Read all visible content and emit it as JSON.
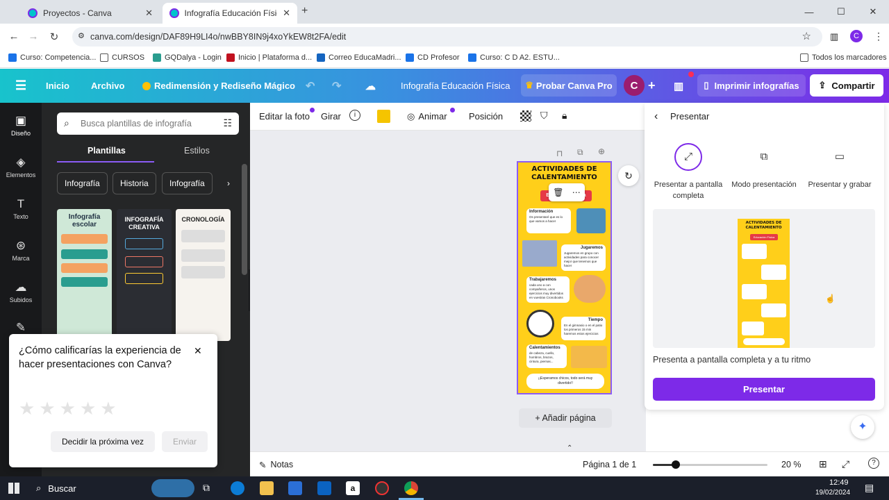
{
  "browser": {
    "tabs": [
      {
        "title": "Proyectos - Canva"
      },
      {
        "title": "Infografía Educación Física - Inf"
      }
    ],
    "url": "canva.com/design/DAF89H9LI4o/nwBBY8IN9j4xoYkEW8t2FA/edit",
    "bookmarks": [
      "Curso: Competencia...",
      "CURSOS",
      "GQDalya - Login",
      "Inicio | Plataforma d...",
      "Correo EducaMadri...",
      "CD Profesor",
      "Curso: C D A2. ESTU..."
    ],
    "bookmarks_all": "Todos los marcadores",
    "profile_initial": "C"
  },
  "canva_header": {
    "inicio": "Inicio",
    "archivo": "Archivo",
    "magic": "Redimensión y Rediseño Mágico",
    "doc_title": "Infografía Educación Física",
    "probar": "Probar Canva Pro",
    "avatar": "C",
    "imprimir": "Imprimir infografías",
    "compartir": "Compartir"
  },
  "rail": [
    "Diseño",
    "Elementos",
    "Texto",
    "Marca",
    "Subidos"
  ],
  "panel": {
    "search_placeholder": "Busca plantillas de infografía",
    "tabs": [
      "Plantillas",
      "Estilos"
    ],
    "chips": [
      "Infografía",
      "Historia",
      "Infografía"
    ],
    "thumbs": [
      {
        "title": "Infografía escolar"
      },
      {
        "title": "INFOGRAFÍA CREATIVA"
      },
      {
        "title": "CRONOLOGÍA"
      }
    ]
  },
  "rating": {
    "question": "¿Cómo calificarías la experiencia de hacer presentaciones con Canva?",
    "later": "Decidir la próxima vez",
    "send": "Enviar",
    "stars_selected": 0,
    "stars_total": 5
  },
  "toolbar": {
    "edit_photo": "Editar la foto",
    "rotate": "Girar",
    "animate": "Animar",
    "position": "Posición",
    "color": "#f5c400"
  },
  "canvas": {
    "add_page": "+ Añadir página",
    "infographic": {
      "title1": "ACTIVIDADES DE",
      "title2": "CALENTAMIENTO",
      "subtitle": "Educación Física",
      "sections": [
        {
          "heading": "Información",
          "body": "Os presentaré que es lo que vamos a hacer"
        },
        {
          "heading": "Jugaremos",
          "body": "Jugaremos en grupo con actividades para conocer mejor que tenemos que hacer"
        },
        {
          "heading": "Trabajaremos",
          "body": "cada uno a con compañeros, unos ejercicios muy divertidos en vuestras Cronobooks"
        },
        {
          "heading": "Tiempo",
          "body": "En el gimnasio o en el patio los primeros 15 min haremos estos ejercicios"
        },
        {
          "heading": "Calentamientos",
          "body": "de cabeza, cuello, hombros, brazos, cintura, piernas..."
        }
      ],
      "footer": "¡¡Esperamos chicos, todo será muy divertido!!"
    }
  },
  "present_panel": {
    "title": "Presentar",
    "options": [
      "Presentar a pantalla completa",
      "Modo presentación",
      "Presentar y grabar"
    ],
    "description": "Presenta a pantalla completa y a tu ritmo",
    "button": "Presentar"
  },
  "statusbar": {
    "notes": "Notas",
    "page": "Página 1 de 1",
    "zoom": "20 %",
    "zoom_level": 0.2
  },
  "taskbar": {
    "search": "Buscar",
    "time": "12:49",
    "date": "19/02/2024"
  }
}
